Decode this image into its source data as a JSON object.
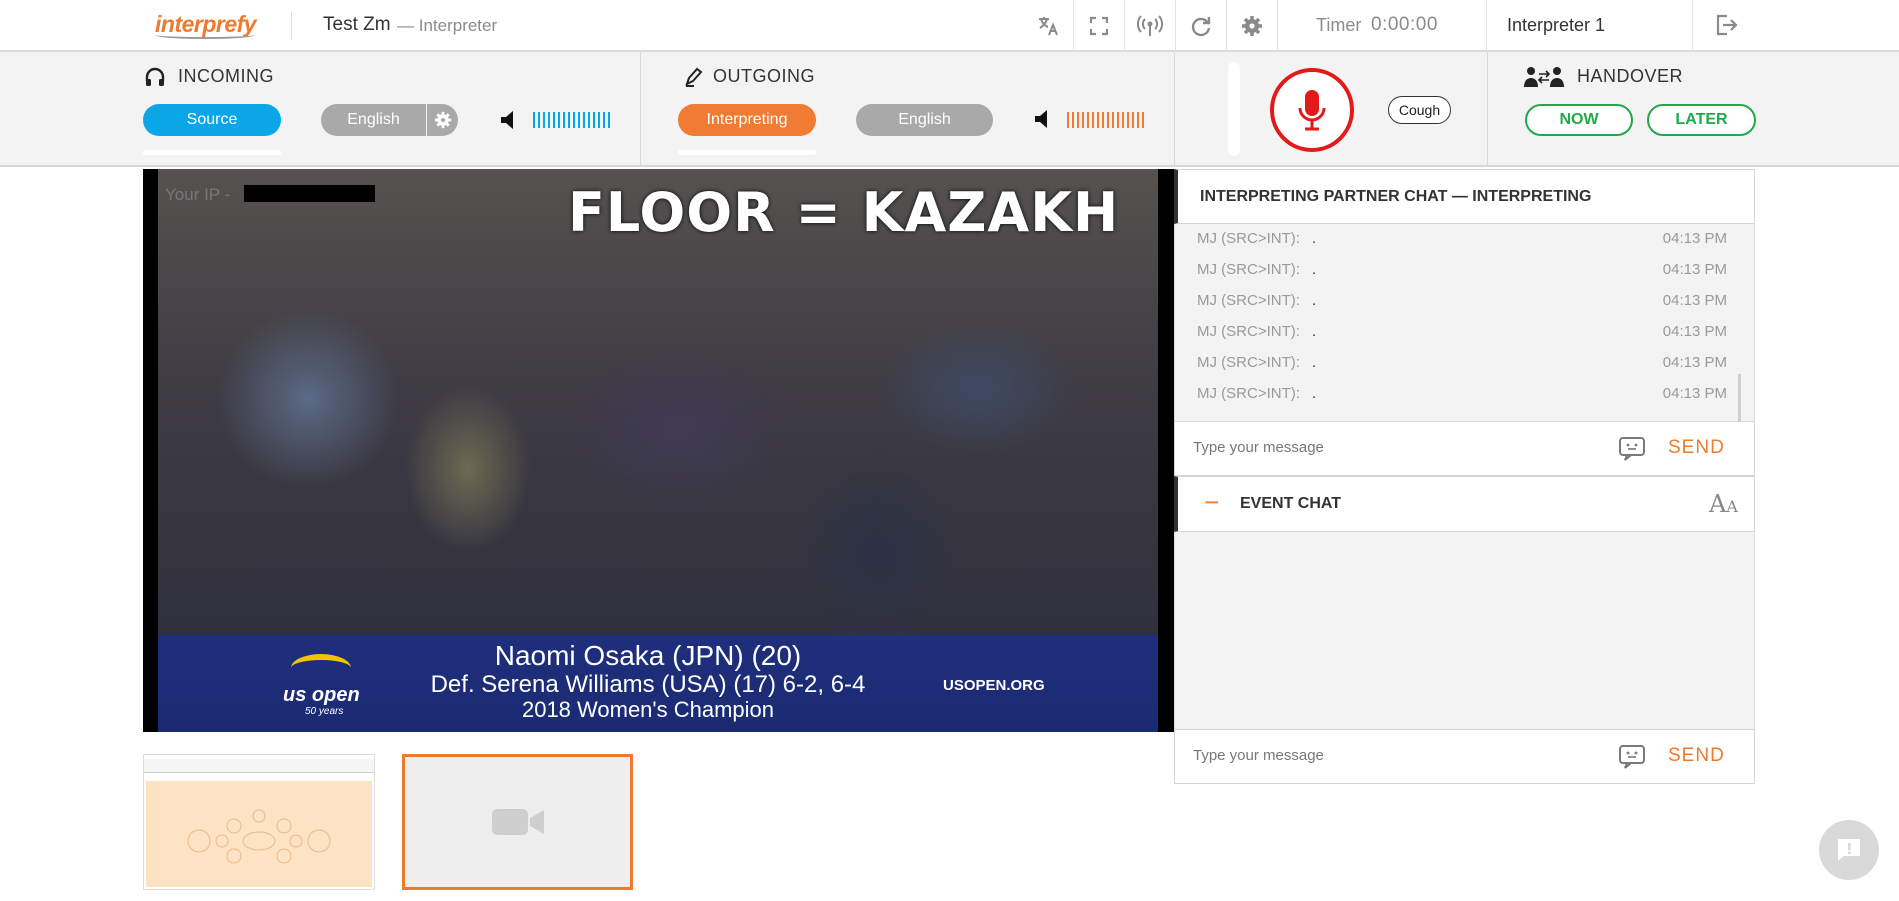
{
  "header": {
    "logo_text": "interprefy",
    "session_title": "Test Zm",
    "session_role": "— Interpreter",
    "toolbar_icons": [
      "translate-icon",
      "fullscreen-icon",
      "broadcast-icon",
      "refresh-icon",
      "gear-icon"
    ],
    "timer_label": "Timer",
    "timer_value": "0:00:00",
    "interpreter_name": "Interpreter 1"
  },
  "incoming": {
    "title": "INCOMING",
    "source_label": "Source",
    "language": "English",
    "accent_color": "#0aa6e8"
  },
  "outgoing": {
    "title": "OUTGOING",
    "interpreting_label": "Interpreting",
    "language": "English",
    "accent_color": "#f07b33"
  },
  "controls": {
    "cough_label": "Cough"
  },
  "handover": {
    "title": "HANDOVER",
    "now_label": "NOW",
    "later_label": "LATER"
  },
  "video": {
    "floor_overlay": "FLOOR = KAZAKH",
    "ip_label": "Your IP -",
    "caption_line1": "Naomi Osaka (JPN) (20)",
    "caption_line2": "Def. Serena Williams (USA) (17) 6-2, 6-4",
    "caption_line3": "2018 Women's Champion",
    "logo_text": "us open",
    "logo_sub": "50 years",
    "site": "USOPEN.ORG"
  },
  "partner_chat": {
    "title": "INTERPRETING PARTNER CHAT — INTERPRETING",
    "messages": [
      {
        "who": "MJ (SRC>INT):",
        "text": ".",
        "time": "04:13 PM"
      },
      {
        "who": "MJ (SRC>INT):",
        "text": ".",
        "time": "04:13 PM"
      },
      {
        "who": "MJ (SRC>INT):",
        "text": ".",
        "time": "04:13 PM"
      },
      {
        "who": "MJ (SRC>INT):",
        "text": ".",
        "time": "04:13 PM"
      },
      {
        "who": "MJ (SRC>INT):",
        "text": ".",
        "time": "04:13 PM"
      },
      {
        "who": "MJ (SRC>INT):",
        "text": ".",
        "time": "04:13 PM"
      }
    ],
    "placeholder": "Type your message",
    "send_label": "SEND"
  },
  "event_chat": {
    "collapse_symbol": "−",
    "title": "EVENT CHAT",
    "placeholder": "Type your message",
    "send_label": "SEND"
  }
}
